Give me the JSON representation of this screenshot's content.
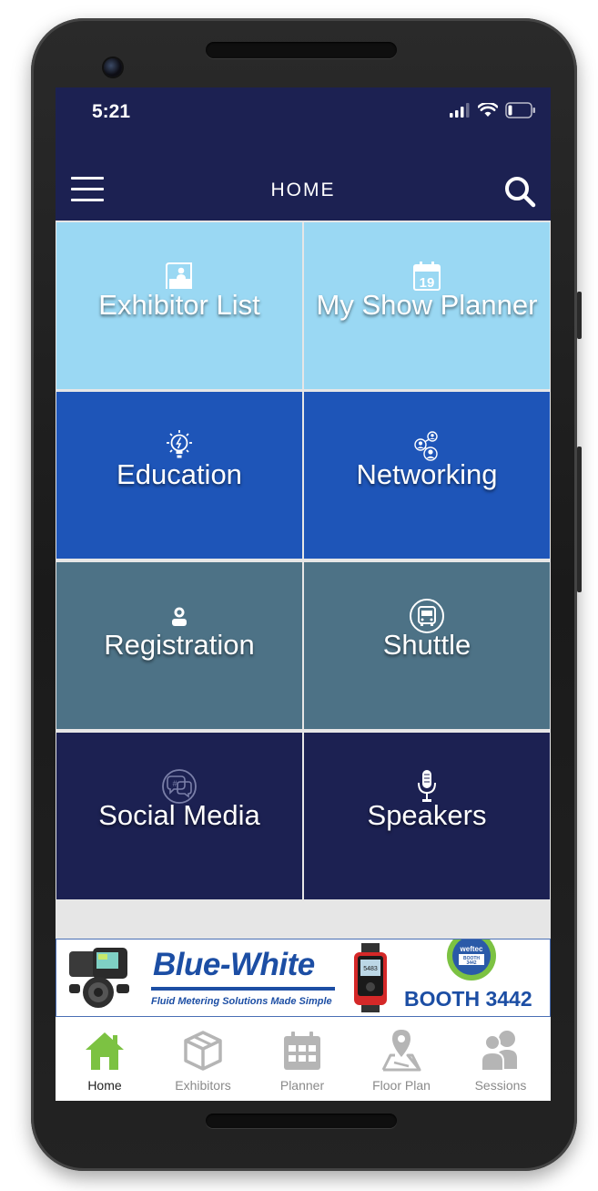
{
  "status_bar": {
    "time": "5:21"
  },
  "header": {
    "title": "HOME"
  },
  "tiles": [
    {
      "label": "Exhibitor List",
      "bg": "#9ad8f3",
      "icon": "exhibitor-booth-icon"
    },
    {
      "label": "My Show Planner",
      "bg": "#9ad8f3",
      "icon": "calendar-icon"
    },
    {
      "label": "Education",
      "bg": "#1e55b8",
      "icon": "lightbulb-icon"
    },
    {
      "label": "Networking",
      "bg": "#1e55b8",
      "icon": "network-people-icon"
    },
    {
      "label": "Registration",
      "bg": "#4d7286",
      "icon": "person-icon"
    },
    {
      "label": "Shuttle",
      "bg": "#4d7286",
      "icon": "bus-icon"
    },
    {
      "label": "Social Media",
      "bg": "#1c2152",
      "icon": "chat-bubbles-icon"
    },
    {
      "label": "Speakers",
      "bg": "#1c2152",
      "icon": "microphone-icon"
    }
  ],
  "banner": {
    "brand": "Blue-White",
    "tagline": "Fluid Metering Solutions Made Simple",
    "booth": "BOOTH 3442",
    "badge_brand": "weftec",
    "badge_booth": "BOOTH",
    "badge_number": "3442"
  },
  "tabs": [
    {
      "label": "Home",
      "icon": "home-icon",
      "active": true
    },
    {
      "label": "Exhibitors",
      "icon": "box-icon",
      "active": false
    },
    {
      "label": "Planner",
      "icon": "calendar-icon",
      "active": false
    },
    {
      "label": "Floor Plan",
      "icon": "map-pin-icon",
      "active": false
    },
    {
      "label": "Sessions",
      "icon": "people-icon",
      "active": false
    }
  ],
  "colors": {
    "header_bg": "#1c2152",
    "tab_active": "#7cc242",
    "tab_inactive": "#b5b5b5",
    "brand_blue": "#1c4ea4"
  }
}
